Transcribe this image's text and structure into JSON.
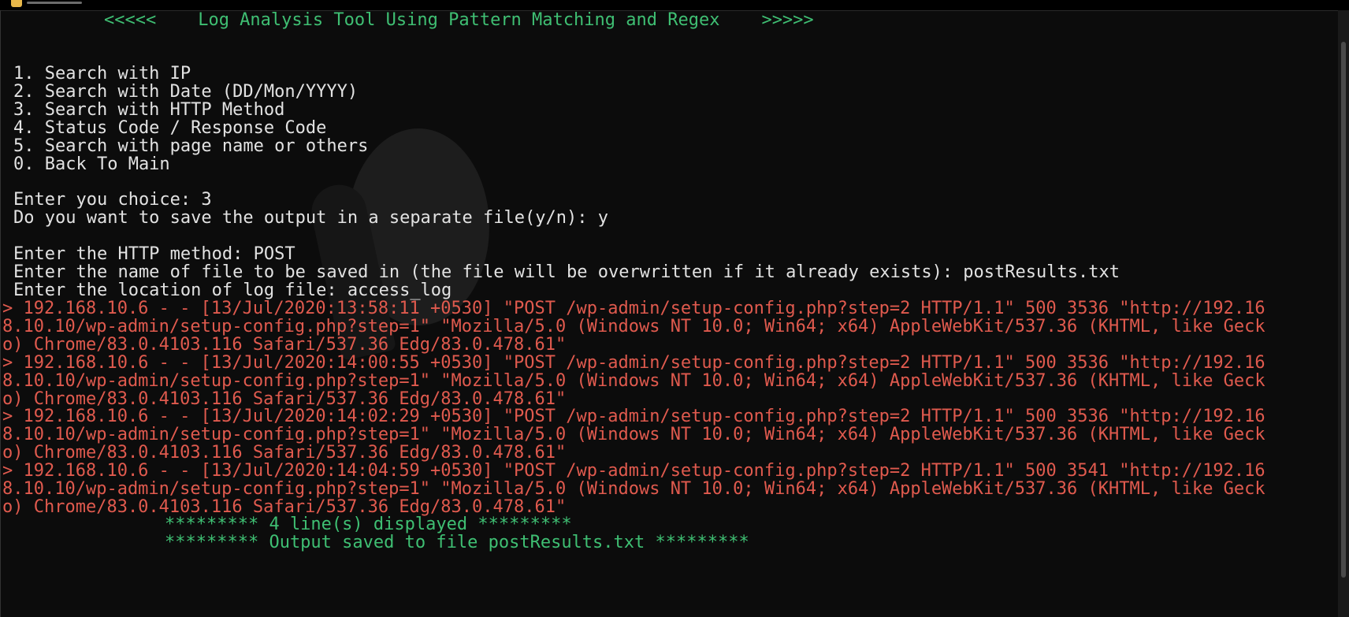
{
  "colors": {
    "background": "#0c0c0c",
    "text": "#e2e2e2",
    "banner": "#3fbf73",
    "log_match": "#e05a4e"
  },
  "banner": "<<<<<    Log Analysis Tool Using Pattern Matching and Regex    >>>>>",
  "menu": [
    "1. Search with IP",
    "2. Search with Date (DD/Mon/YYYY)",
    "3. Search with HTTP Method",
    "4. Status Code / Response Code",
    "5. Search with page name or others",
    "0. Back To Main"
  ],
  "prompts": {
    "choice": "Enter you choice: 3",
    "save": "Do you want to save the output in a separate file(y/n): y",
    "method": "Enter the HTTP method: POST",
    "filename": "Enter the name of file to be saved in (the file will be overwritten if it already exists): postResults.txt",
    "location": "Enter the location of log file: access_log"
  },
  "results": [
    [
      "> 192.168.10.6 - - [13/Jul/2020:13:58:11 +0530] \"POST /wp-admin/setup-config.php?step=2 HTTP/1.1\" 500 3536 \"http://192.16",
      "8.10.10/wp-admin/setup-config.php?step=1\" \"Mozilla/5.0 (Windows NT 10.0; Win64; x64) AppleWebKit/537.36 (KHTML, like Geck",
      "o) Chrome/83.0.4103.116 Safari/537.36 Edg/83.0.478.61\""
    ],
    [
      "> 192.168.10.6 - - [13/Jul/2020:14:00:55 +0530] \"POST /wp-admin/setup-config.php?step=2 HTTP/1.1\" 500 3536 \"http://192.16",
      "8.10.10/wp-admin/setup-config.php?step=1\" \"Mozilla/5.0 (Windows NT 10.0; Win64; x64) AppleWebKit/537.36 (KHTML, like Geck",
      "o) Chrome/83.0.4103.116 Safari/537.36 Edg/83.0.478.61\""
    ],
    [
      "> 192.168.10.6 - - [13/Jul/2020:14:02:29 +0530] \"POST /wp-admin/setup-config.php?step=2 HTTP/1.1\" 500 3536 \"http://192.16",
      "8.10.10/wp-admin/setup-config.php?step=1\" \"Mozilla/5.0 (Windows NT 10.0; Win64; x64) AppleWebKit/537.36 (KHTML, like Geck",
      "o) Chrome/83.0.4103.116 Safari/537.36 Edg/83.0.478.61\""
    ],
    [
      "> 192.168.10.6 - - [13/Jul/2020:14:04:59 +0530] \"POST /wp-admin/setup-config.php?step=2 HTTP/1.1\" 500 3541 \"http://192.16",
      "8.10.10/wp-admin/setup-config.php?step=1\" \"Mozilla/5.0 (Windows NT 10.0; Win64; x64) AppleWebKit/537.36 (KHTML, like Geck",
      "o) Chrome/83.0.4103.116 Safari/537.36 Edg/83.0.478.61\""
    ]
  ],
  "summary": {
    "lines_displayed": "********* 4 line(s) displayed *********",
    "saved": "********* Output saved to file postResults.txt *********"
  }
}
